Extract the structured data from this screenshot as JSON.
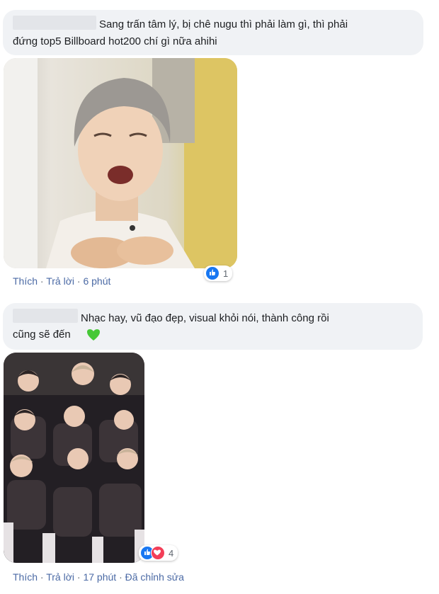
{
  "comments": [
    {
      "text_line1": "Sang trấn tâm lý, bị chê nugu thì phải làm gì, thì phải",
      "text_line2": "đứng top5 Billboard hot200 chí gì nữa ahihi",
      "actions": {
        "like": "Thích",
        "reply": "Trả lời",
        "time": "6 phút"
      },
      "reaction_count": "1",
      "reactions": [
        "like-icon"
      ],
      "photo": "person-gasping-photo"
    },
    {
      "text_line1": "Nhạc hay, vũ đạo đẹp, visual khỏi nói, thành công rồi",
      "text_line2": "cũng sẽ đến",
      "emoji": "green-heart-icon",
      "actions": {
        "like": "Thích",
        "reply": "Trả lời",
        "time": "17 phút",
        "edited": "Đã chỉnh sửa"
      },
      "reaction_count": "4",
      "reactions": [
        "like-icon",
        "love-icon"
      ],
      "photo": "group-photo"
    }
  ],
  "colors": {
    "bubble": "#f0f2f5",
    "link": "#4b6aa5",
    "like": "#1877f2",
    "love": "#f33e58",
    "green_heart": "#46c837"
  }
}
